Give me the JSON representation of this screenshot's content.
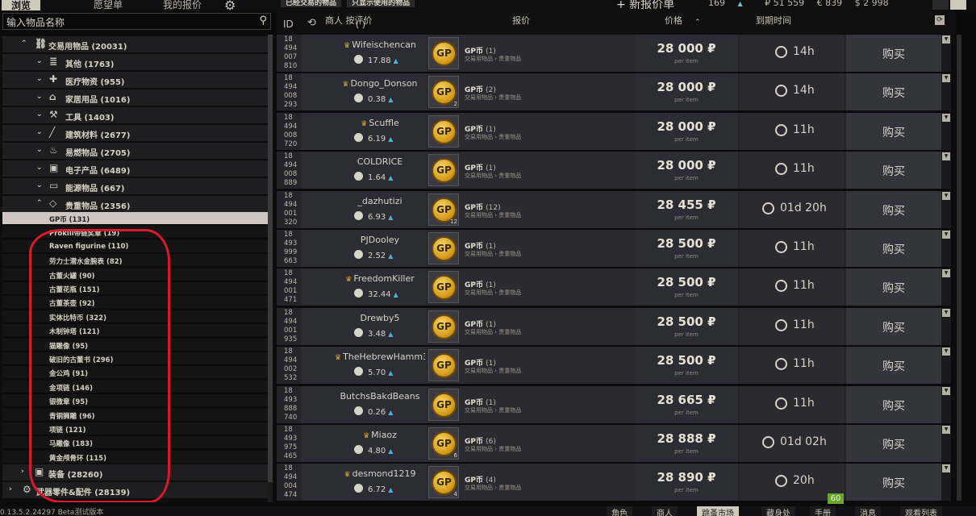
{
  "tabs": {
    "browse": "浏览",
    "wishlist": "愿望单",
    "my_offers": "我的报价"
  },
  "recent": [
    "已经交易的物品",
    "只显示使用的物品"
  ],
  "new_offer": "+ 新报价单",
  "currency": {
    "level": "169",
    "rub": "₽ 51 559",
    "eur": "€ 839",
    "usd": "$ 2 998"
  },
  "search": {
    "placeholder": "输入物品名称"
  },
  "sidebar": {
    "parent": {
      "label": "交易用物品 (20031)",
      "icon": "barter-icon"
    },
    "categories": [
      {
        "label": "其他 (1763)",
        "icon": "stack-icon"
      },
      {
        "label": "医疗物资 (955)",
        "icon": "medical-icon"
      },
      {
        "label": "家居用品 (1016)",
        "icon": "household-icon"
      },
      {
        "label": "工具 (1403)",
        "icon": "tools-icon"
      },
      {
        "label": "建筑材料 (2677)",
        "icon": "building-icon"
      },
      {
        "label": "易燃物品 (2705)",
        "icon": "flame-icon"
      },
      {
        "label": "电子产品 (6489)",
        "icon": "chip-icon"
      },
      {
        "label": "能源物品 (667)",
        "icon": "battery-icon"
      },
      {
        "label": "贵重物品 (2356)",
        "icon": "diamond-icon"
      }
    ],
    "valuables": [
      "GP币 (131)",
      "Prokill带链奖章 (19)",
      "Raven figurine (110)",
      "劳力士潜水金腕表 (82)",
      "古董火罐 (90)",
      "古董花瓶 (151)",
      "古董茶壶 (92)",
      "实体比特币 (322)",
      "木制钟塔 (121)",
      "猫雕像 (95)",
      "破旧的古董书 (296)",
      "金公鸡 (91)",
      "金项链 (146)",
      "银微章 (95)",
      "青铜狮雕 (96)",
      "项链 (121)",
      "马雕像 (183)",
      "黄金颅骨环 (115)"
    ],
    "bottom": [
      {
        "label": "装备 (28260)",
        "icon": "gear-equipment-icon"
      },
      {
        "label": "武器零件&配件 (28139)",
        "icon": "weapon-parts-icon"
      }
    ]
  },
  "table_header": {
    "id": "ID",
    "seller": "商人 按评价",
    "seller_paren": "(         )",
    "offer": "报价",
    "price": "价格",
    "expires": "到期时间"
  },
  "listings": [
    {
      "id": [
        "18",
        "494",
        "007",
        "810"
      ],
      "seller": "Wifeischencan",
      "crown": true,
      "rating": "17.88",
      "qty": "1",
      "badge": "",
      "price": "28 000 ₽",
      "expires": "14h",
      "wide": false
    },
    {
      "id": [
        "18",
        "494",
        "008",
        "293"
      ],
      "seller": "Dongo_Donson",
      "crown": true,
      "rating": "0.38",
      "qty": "2",
      "badge": "2",
      "price": "28 000 ₽",
      "expires": "14h",
      "wide": false
    },
    {
      "id": [
        "18",
        "494",
        "008",
        "720"
      ],
      "seller": "Scuffle",
      "crown": true,
      "rating": "6.19",
      "qty": "1",
      "badge": "",
      "price": "28 000 ₽",
      "expires": "11h",
      "wide": false
    },
    {
      "id": [
        "18",
        "494",
        "008",
        "889"
      ],
      "seller": "COLDRICE",
      "crown": false,
      "rating": "1.64",
      "qty": "1",
      "badge": "",
      "price": "28 000 ₽",
      "expires": "11h",
      "wide": false
    },
    {
      "id": [
        "18",
        "494",
        "001",
        "320"
      ],
      "seller": "_dazhutizi",
      "crown": false,
      "rating": "6.93",
      "qty": "12",
      "badge": "12",
      "price": "28 455 ₽",
      "expires": "01d 20h",
      "wide": true
    },
    {
      "id": [
        "18",
        "493",
        "999",
        "663"
      ],
      "seller": "PJDooley",
      "crown": false,
      "rating": "2.52",
      "qty": "1",
      "badge": "",
      "price": "28 500 ₽",
      "expires": "11h",
      "wide": false
    },
    {
      "id": [
        "18",
        "494",
        "001",
        "471"
      ],
      "seller": "FreedomKiller",
      "crown": true,
      "rating": "32.44",
      "qty": "1",
      "badge": "",
      "price": "28 500 ₽",
      "expires": "11h",
      "wide": false
    },
    {
      "id": [
        "18",
        "494",
        "001",
        "935"
      ],
      "seller": "Drewby5",
      "crown": false,
      "rating": "3.48",
      "qty": "1",
      "badge": "",
      "price": "28 500 ₽",
      "expires": "11h",
      "wide": false
    },
    {
      "id": [
        "18",
        "494",
        "002",
        "532"
      ],
      "seller": "TheHebrewHamm3r",
      "crown": true,
      "rating": "5.70",
      "qty": "1",
      "badge": "",
      "price": "28 500 ₽",
      "expires": "11h",
      "wide": false
    },
    {
      "id": [
        "18",
        "493",
        "888",
        "740"
      ],
      "seller": "ButchsBakdBeans",
      "crown": false,
      "rating": "0.26",
      "qty": "1",
      "badge": "",
      "price": "28 665 ₽",
      "expires": "11h",
      "wide": false
    },
    {
      "id": [
        "18",
        "493",
        "975",
        "465"
      ],
      "seller": "Miaoz",
      "crown": true,
      "rating": "4.80",
      "qty": "6",
      "badge": "6",
      "price": "28 888 ₽",
      "expires": "01d 02h",
      "wide": true
    },
    {
      "id": [
        "18",
        "494",
        "004",
        "474"
      ],
      "seller": "desmond1219",
      "crown": true,
      "rating": "6.72",
      "qty": "4",
      "badge": "4",
      "price": "28 890 ₽",
      "expires": "20h",
      "wide": false
    }
  ],
  "item_name": "GP币",
  "item_category": "交易用物品 › 贵重物品",
  "per_item": "per item",
  "buy_label": "购买",
  "coin_text": "GP",
  "fps": "60",
  "build": "0.13.5.2.24297 Beta测试版本",
  "bottom_nav": [
    "角色",
    "商人",
    "跳蚤市场",
    "藏身处",
    "手册",
    "消息",
    "观看列表"
  ]
}
